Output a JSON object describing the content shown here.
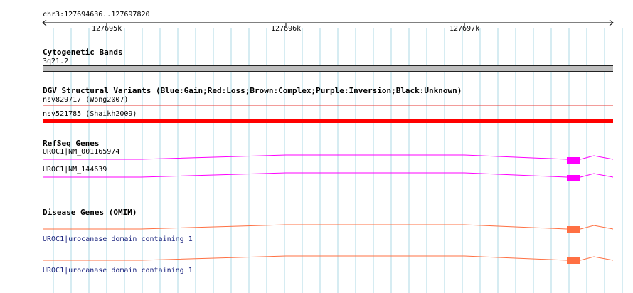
{
  "ruler": {
    "location": "chr3:127694636..127697820",
    "ticks": [
      "127695k",
      "127696k",
      "127697k"
    ]
  },
  "tracks": {
    "cytoband": {
      "title": "Cytogenetic Bands",
      "band_label": "3q21.2",
      "band_color": "#bdbdbd"
    },
    "dgv": {
      "title": "DGV Structural Variants (Blue:Gain;Red:Loss;Brown:Complex;Purple:Inversion;Black:Unknown)",
      "features": [
        {
          "label": "nsv829717 (Wong2007)",
          "color": "#e53935"
        },
        {
          "label": "nsv521785 (Shaikh2009)",
          "color": "#ff0000"
        }
      ]
    },
    "refseq": {
      "title": "RefSeq Genes",
      "features": [
        {
          "label": "UROC1|NM_001165974",
          "color": "#ff00ff"
        },
        {
          "label": "UROC1|NM_144639",
          "color": "#ff00ff"
        }
      ]
    },
    "omim": {
      "title": "Disease Genes (OMIM)",
      "features": [
        {
          "label": "UROC1|urocanase domain containing 1",
          "color": "#ff7043"
        },
        {
          "label": "UROC1|urocanase domain containing 1",
          "color": "#ff7043"
        }
      ]
    }
  },
  "colors": {
    "gridline": "#add8e6",
    "refseq": "#ff00ff",
    "omim": "#ff7043",
    "loss": "#ff0000"
  }
}
